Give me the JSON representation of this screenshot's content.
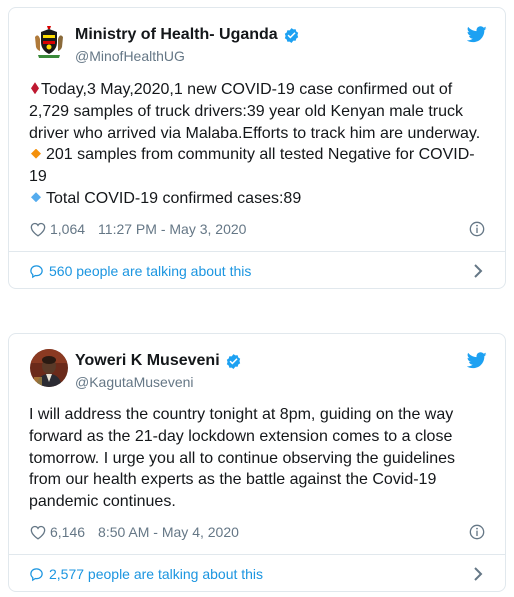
{
  "tweets": [
    {
      "author": "Ministry of Health- Uganda",
      "handle": "@MinofHealthUG",
      "lines": [
        "Today,3 May,2020,1 new COVID-19 case confirmed out of",
        "2,729 samples of truck drivers:39 year old Kenyan male truck",
        "driver who arrived via Malaba.Efforts to track him are underway.",
        "201 samples from community all tested Negative for COVID-",
        "19",
        "Total COVID-19 confirmed cases:89"
      ],
      "likes": "1,064",
      "timestamp": "11:27 PM - May 3, 2020",
      "talking": "560 people are talking about this",
      "avatar_icon": "uganda-coat-of-arms-icon"
    },
    {
      "author": "Yoweri K Museveni",
      "handle": "@KagutaMuseveni",
      "lines": [
        "I will address the country tonight at 8pm, guiding on the way",
        "forward as the 21-day lockdown extension comes to a close",
        "tomorrow. I urge you all to continue observing the guidelines",
        "from our health experts as the battle against the Covid-19",
        "pandemic continues."
      ],
      "likes": "6,146",
      "timestamp": "8:50 AM - May 4, 2020",
      "talking": "2,577 people are talking about this",
      "avatar_icon": "profile-photo"
    }
  ],
  "colors": {
    "verified": "#1da1f2",
    "link": "#1b95e0",
    "muted": "#657786",
    "border": "#e1e8ed",
    "red_diamond": "#be1931",
    "orange_diamond": "#f4900c",
    "blue_diamond": "#55acee"
  }
}
